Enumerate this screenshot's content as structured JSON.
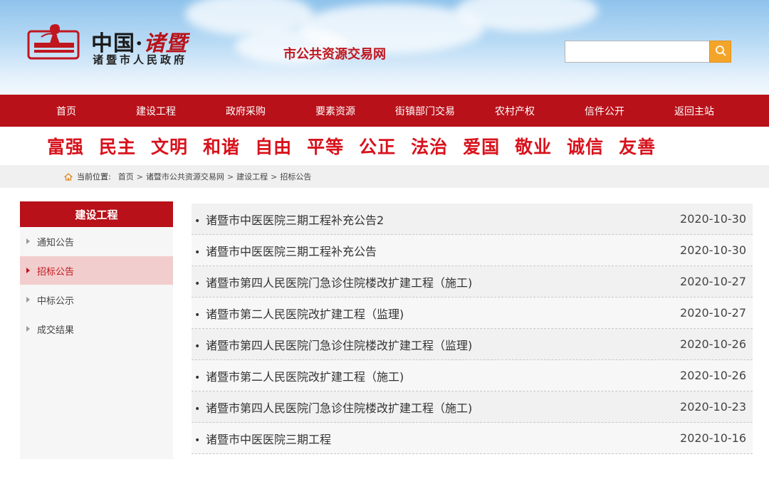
{
  "header": {
    "logo_main": "中国·",
    "logo_main_accent": "诸暨",
    "logo_sub": "诸暨市人民政府",
    "site_name": "市公共资源交易网",
    "search_placeholder": ""
  },
  "nav": {
    "items": [
      "首页",
      "建设工程",
      "政府采购",
      "要素资源",
      "街镇部门交易",
      "农村产权",
      "信件公开",
      "返回主站"
    ]
  },
  "slogans": [
    "富强",
    "民主",
    "文明",
    "和谐",
    "自由",
    "平等",
    "公正",
    "法治",
    "爱国",
    "敬业",
    "诚信",
    "友善"
  ],
  "breadcrumb": {
    "label": "当前位置:",
    "items": [
      "首页",
      "诸暨市公共资源交易网",
      "建设工程",
      "招标公告"
    ],
    "separator": ">"
  },
  "sidebar": {
    "title": "建设工程",
    "items": [
      "通知公告",
      "招标公告",
      "中标公示",
      "成交结果"
    ],
    "active_index": 1
  },
  "list": {
    "rows": [
      {
        "title": "诸暨市中医医院三期工程补充公告2",
        "date": "2020-10-30"
      },
      {
        "title": "诸暨市中医医院三期工程补充公告",
        "date": "2020-10-30"
      },
      {
        "title": "诸暨市第四人民医院门急诊住院楼改扩建工程（施工)",
        "date": "2020-10-27"
      },
      {
        "title": "诸暨市第二人民医院改扩建工程（监理)",
        "date": "2020-10-27"
      },
      {
        "title": "诸暨市第四人民医院门急诊住院楼改扩建工程（监理)",
        "date": "2020-10-26"
      },
      {
        "title": "诸暨市第二人民医院改扩建工程（施工)",
        "date": "2020-10-26"
      },
      {
        "title": "诸暨市第四人民医院门急诊住院楼改扩建工程（施工)",
        "date": "2020-10-23"
      },
      {
        "title": "诸暨市中医医院三期工程",
        "date": "2020-10-16"
      }
    ]
  },
  "colors": {
    "brand_red": "#b8111a",
    "slogan_red": "#d8121c",
    "search_button": "#f3a52a",
    "sidebar_active_bg": "#f2cdcd"
  }
}
